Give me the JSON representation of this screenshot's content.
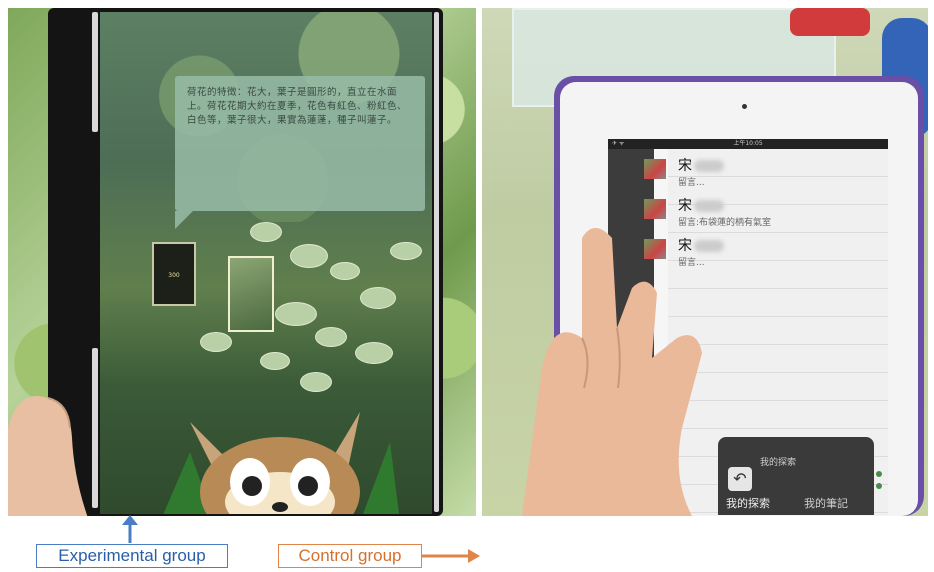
{
  "left_panel": {
    "info_text": "荷花的特徵：花大，葉子是圓形的，直立在水面上。荷花花期大約在夏季，花色有紅色、粉紅色、白色等，葉子很大，果實為蓮蓬，種子叫蓮子。",
    "thumb_label": "300"
  },
  "right_panel": {
    "status_time": "上午10:05",
    "messages": [
      {
        "name": "宋",
        "body": "留言..."
      },
      {
        "name": "宋",
        "body": "留言:布袋蓮的柄有氣室"
      },
      {
        "name": "宋",
        "body": "留言..."
      }
    ],
    "bottom_panel": {
      "title": "我的探索",
      "tab_explore": "我的探索",
      "tab_album": "我的筆記"
    }
  },
  "captions": {
    "experimental": "Experimental group",
    "control": "Control group"
  },
  "colors": {
    "experimental_accent": "#4a7ec4",
    "control_accent": "#e0854a",
    "ipad_case": "#6a4fa6"
  }
}
